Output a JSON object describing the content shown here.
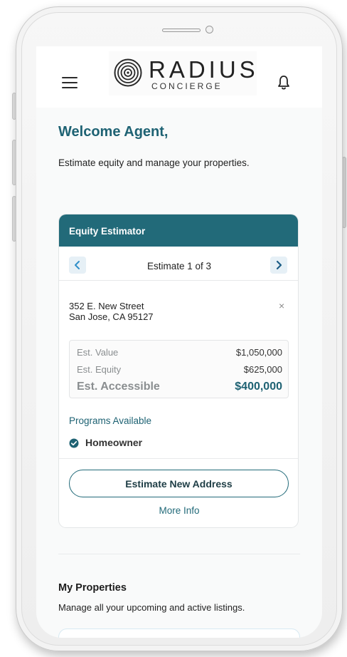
{
  "header": {
    "logo": {
      "word": "RADIUS",
      "sub": "CONCIERGE"
    },
    "icons": {
      "menu": "hamburger-menu-icon",
      "notifications": "bell-icon",
      "logo_mark": "concentric-circles-icon"
    }
  },
  "welcome": {
    "title": "Welcome Agent,",
    "subtitle": "Estimate equity and manage your properties."
  },
  "estimator": {
    "title": "Equity Estimator",
    "nav_label": "Estimate 1 of 3",
    "address_line1": "352 E. New Street",
    "address_line2": "San Jose, CA 95127",
    "close": "×",
    "rows": [
      {
        "label": "Est. Value",
        "value": "$1,050,000"
      },
      {
        "label": "Est. Equity",
        "value": "$625,000"
      },
      {
        "label": "Est. Accessible",
        "value": "$400,000"
      }
    ],
    "programs_title": "Programs Available",
    "programs": [
      "Homeowner"
    ],
    "cta": "Estimate New Address",
    "more_info": "More Info"
  },
  "properties": {
    "title": "My Properties",
    "subtitle": "Manage all your upcoming and active listings."
  },
  "colors": {
    "brand": "#226a79",
    "brand_text": "#1e6273",
    "nav_button_bg": "#e6f0f6"
  }
}
